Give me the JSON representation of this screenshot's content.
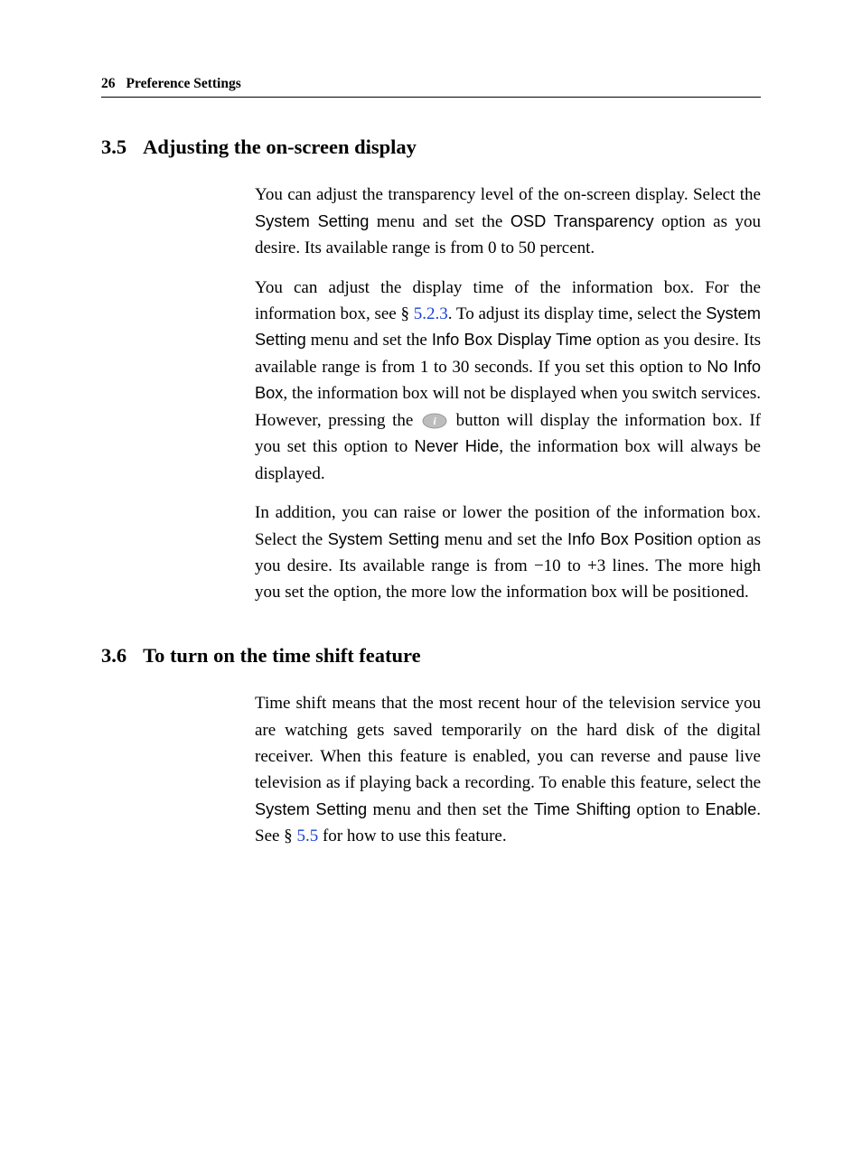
{
  "header": {
    "page_number": "26",
    "chapter_title": "Preference Settings"
  },
  "sections": {
    "s35": {
      "number": "3.5",
      "title": "Adjusting the on-screen display",
      "p1": {
        "t1": "You can adjust the transparency level of the on-screen display. Select the ",
        "ui1": "System Setting",
        "t2": " menu and set the ",
        "ui2": "OSD Transparency",
        "t3": " option as you desire. Its available range is from 0 to 50 percent."
      },
      "p2": {
        "t1": "You can adjust the display time of the information box. For the information box, see § ",
        "xref1": "5.2.3",
        "t2": ". To adjust its display time, select the ",
        "ui1": "System Setting",
        "t3": " menu and set the ",
        "ui2": "Info Box Display Time",
        "t4": " option as you desire. Its available range is from 1 to 30 seconds. If you set this option to ",
        "ui3": "No Info Box",
        "t5": ", the information box will not be displayed when you switch services. However, pressing the ",
        "t6": " button will display the information box. If you set this option to ",
        "ui4": "Never Hide",
        "t7": ", the information box will always be displayed."
      },
      "p3": {
        "t1": "In addition, you can raise or lower the position of the information box. Select the ",
        "ui1": "System Setting",
        "t2": " menu and set the ",
        "ui2": "Info Box Position",
        "t3": " option as you desire. Its available range is from ",
        "rng_lo": "−10",
        "t4": " to ",
        "rng_hi": "+3",
        "t5": " lines. The more high you set the option, the more low the information box will be positioned."
      }
    },
    "s36": {
      "number": "3.6",
      "title": "To turn on the time shift feature",
      "p1": {
        "t1": "Time shift means that the most recent hour of the television service you are watching gets saved temporarily on the hard disk of the digital receiver. When this feature is enabled, you can reverse and pause live television as if playing back a recording. To enable this feature, select the ",
        "ui1": "System Setting",
        "t2": " menu and then set the ",
        "ui2": "Time Shifting",
        "t3": " option to ",
        "ui3": "Enable",
        "t4": ". See § ",
        "xref1": "5.5",
        "t5": " for how to use this feature."
      }
    }
  }
}
